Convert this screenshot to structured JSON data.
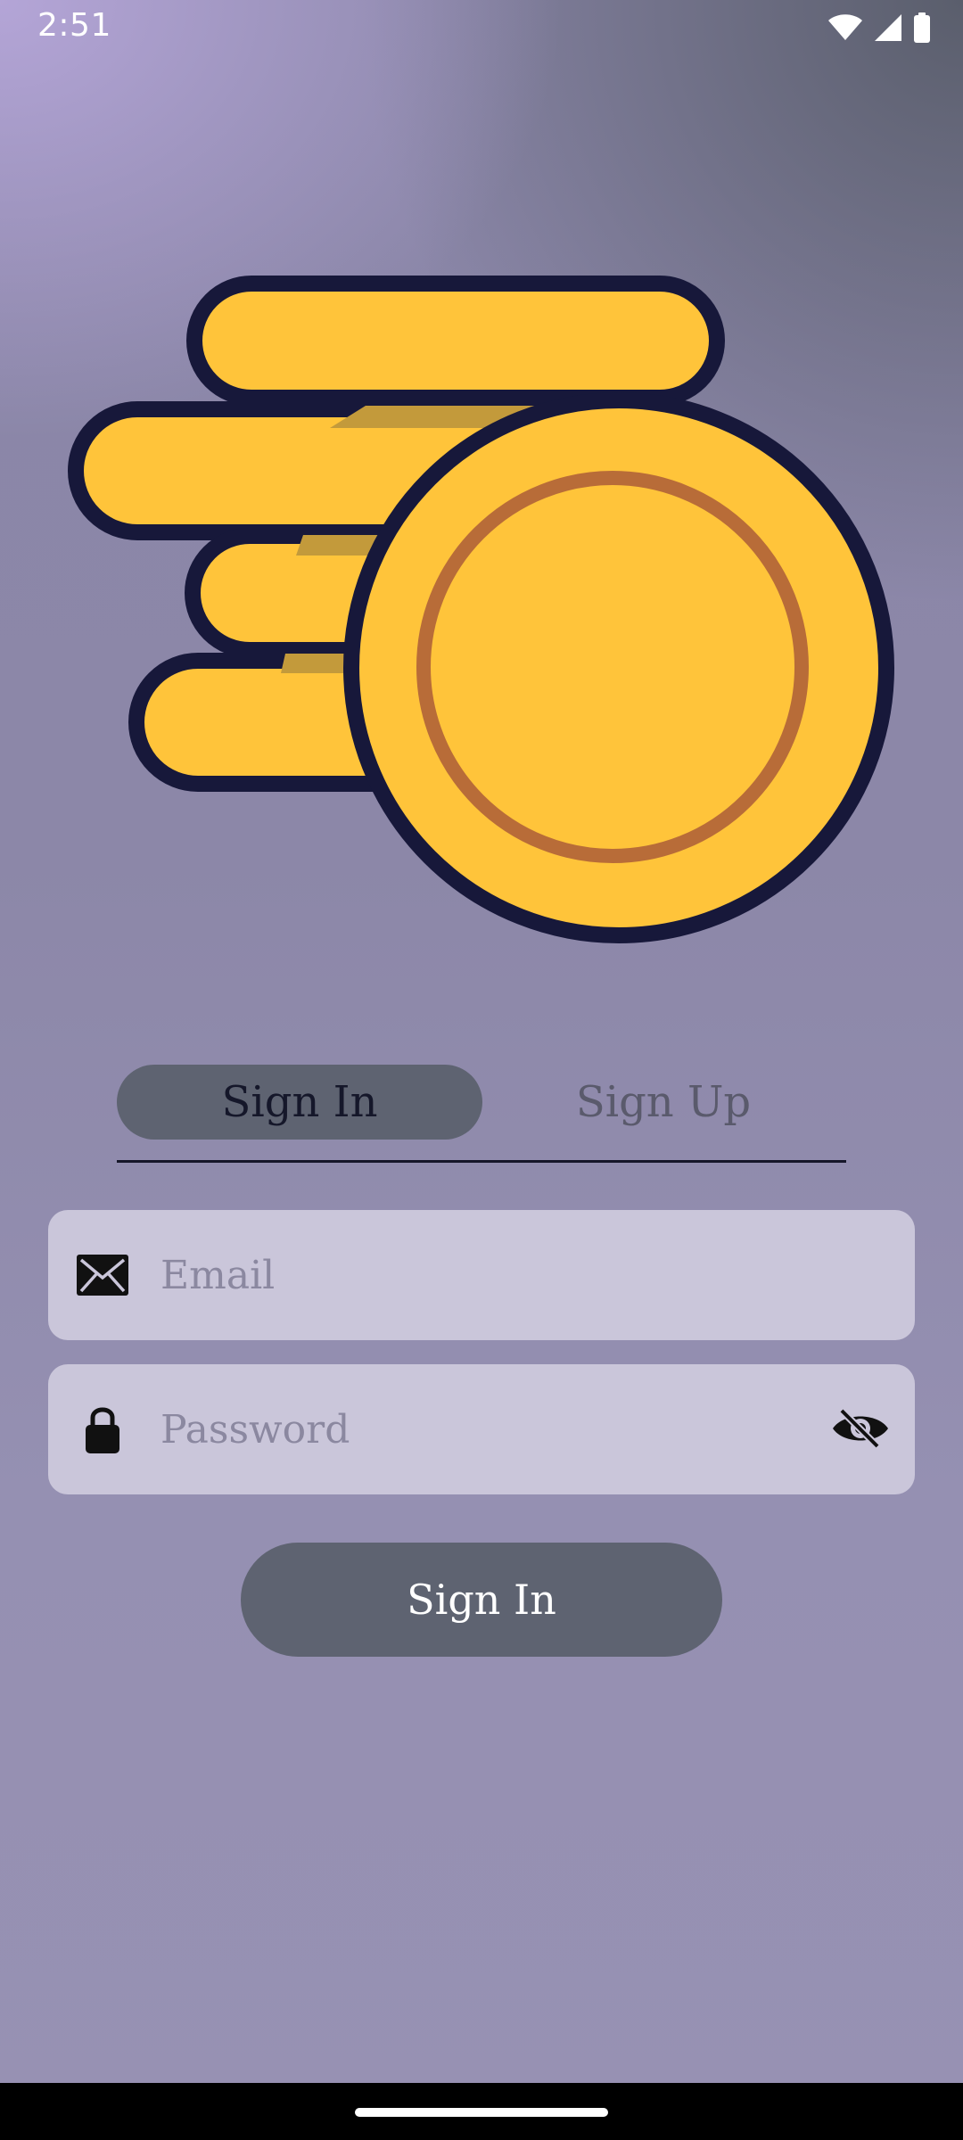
{
  "status_bar": {
    "time": "2:51",
    "icons": [
      "wifi-icon",
      "cell-signal-icon",
      "battery-icon"
    ]
  },
  "hero": {
    "icon": "coins-stack-icon",
    "colors": {
      "coin_fill": "#FFC43A",
      "coin_outline": "#17183A",
      "coin_inner_ring": "#B86C38"
    }
  },
  "tabs": [
    {
      "label": "Sign In",
      "selected": true
    },
    {
      "label": "Sign Up",
      "selected": false
    }
  ],
  "form": {
    "email": {
      "placeholder": "Email",
      "value": "",
      "icon": "envelope-icon"
    },
    "password": {
      "placeholder": "Password",
      "value": "",
      "icon": "lock-icon",
      "toggle_icon": "eye-off-icon"
    },
    "submit_label": "Sign In"
  },
  "colors": {
    "accent": "#5E6371",
    "field_background": "#CAC6DA",
    "text_dark": "#15172A"
  }
}
